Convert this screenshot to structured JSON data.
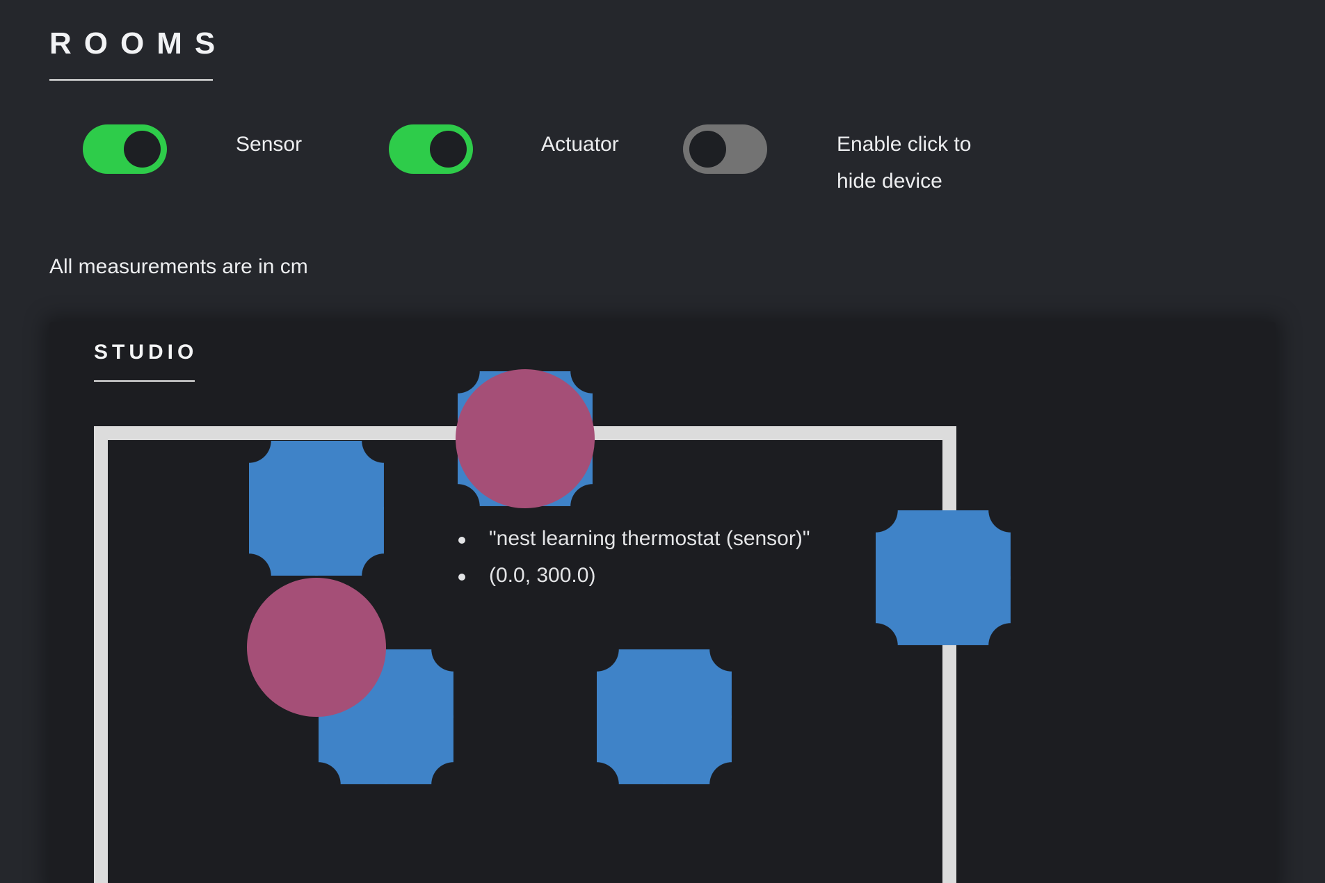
{
  "page": {
    "title": "ROOMS"
  },
  "toggles": [
    {
      "label": "Sensor",
      "state": "on"
    },
    {
      "label": "Actuator",
      "state": "on"
    },
    {
      "label_line1": "Enable click to",
      "label_line2": "hide device",
      "state": "off"
    }
  ],
  "colors": {
    "background": "#25272c",
    "card": "#1c1d21",
    "toggle_on": "#2ecc4a",
    "toggle_off": "#737373",
    "actuator": "#3f83c8",
    "sensor": "#a54f77",
    "room_outline": "#dcdcdc"
  },
  "note": "All measurements are in cm",
  "room": {
    "name": "STUDIO",
    "tooltip": {
      "name": "\"nest learning thermostat (sensor)\"",
      "position": "(0.0, 300.0)"
    }
  }
}
